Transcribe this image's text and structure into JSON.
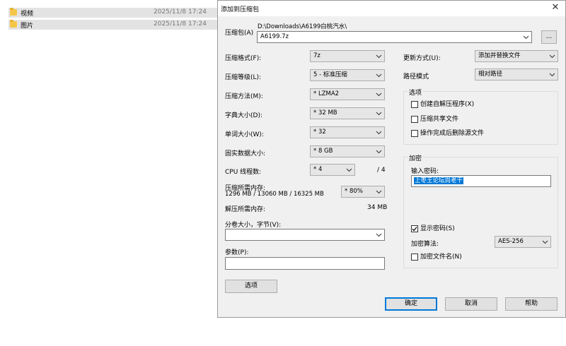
{
  "explorer": {
    "rows": [
      {
        "name": "视频",
        "date": "2025/11/8 17:24"
      },
      {
        "name": "图片",
        "date": "2025/11/8 17:24"
      }
    ]
  },
  "dialog": {
    "title": "添加到压缩包",
    "archive_label": "压缩包(A)",
    "archive_path": "D:\\Downloads\\A6199白桃汽水\\",
    "archive_name": "A6199.7z",
    "browse_label": "...",
    "format_label": "压缩格式(F):",
    "format_value": "7z",
    "level_label": "压缩等级(L):",
    "level_value": "5 - 标准压缩",
    "method_label": "压缩方法(M):",
    "method_value": "* LZMA2",
    "dict_label": "字典大小(D):",
    "dict_value": "* 32 MB",
    "word_label": "单词大小(W):",
    "word_value": "* 32",
    "solid_label": "固实数据大小:",
    "solid_value": "* 8 GB",
    "cpu_label": "CPU 线程数:",
    "cpu_value": "* 4",
    "cpu_total": "/ 4",
    "mem_label": "压缩所需内存:",
    "mem_detail": "1296 MB / 13060 MB / 16325 MB",
    "mem_value": "* 80%",
    "decomp_label": "解压所需内存:",
    "decomp_value": "34 MB",
    "split_label": "分卷大小，字节(V):",
    "split_value": "",
    "params_label": "参数(P):",
    "params_value": "",
    "options_button": "选项",
    "update_label": "更新方式(U):",
    "update_value": "添加并替换文件",
    "path_mode_label": "路径模式",
    "path_mode_value": "相对路径",
    "options_group": {
      "title": "选项",
      "sfx": "创建自解压程序(X)",
      "shared": "压缩共享文件",
      "delete_after": "操作完成后删除源文件"
    },
    "encryption": {
      "title": "加密",
      "password_label": "输入密码:",
      "password_value": "上枣王论坛尚老干",
      "show_password": "显示密码(S)",
      "algo_label": "加密算法:",
      "algo_value": "AES-256",
      "encrypt_names": "加密文件名(N)"
    },
    "ok_button": "确定",
    "cancel_button": "取消",
    "help_button": "帮助"
  }
}
